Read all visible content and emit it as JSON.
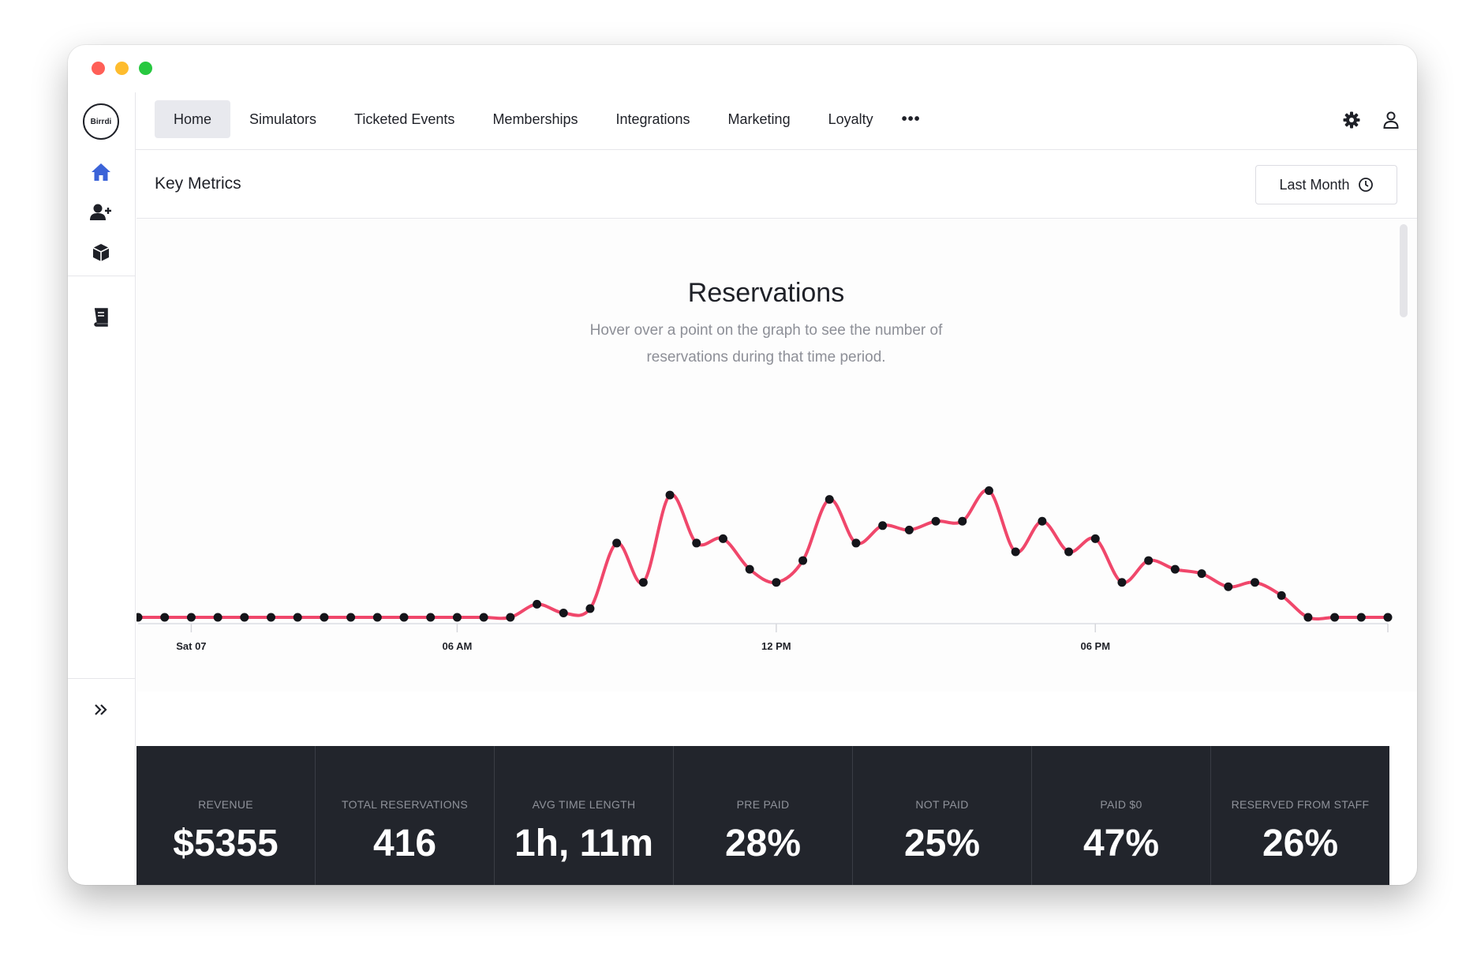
{
  "window": {
    "logo_text": "Birrdi"
  },
  "nav": {
    "items": [
      "Home",
      "Simulators",
      "Ticketed Events",
      "Memberships",
      "Integrations",
      "Marketing",
      "Loyalty"
    ],
    "more": "•••"
  },
  "key_metrics": {
    "title": "Key Metrics",
    "range_label": "Last Month"
  },
  "chart": {
    "title": "Reservations",
    "subtitle_line1": "Hover over a point on the graph to see the number of",
    "subtitle_line2": "reservations during that time period."
  },
  "chart_data": {
    "type": "line",
    "title": "Reservations",
    "xlabel": "",
    "ylabel": "",
    "x_ticks": [
      "Sat 07",
      "06 AM",
      "12 PM",
      "06 PM"
    ],
    "x_tick_hours": [
      1,
      6,
      12,
      18
    ],
    "x_range_hours": [
      0,
      23.5
    ],
    "point_interval_hours": 0.5,
    "values": [
      0,
      0,
      0,
      0,
      0,
      0,
      0,
      0,
      0,
      0,
      0,
      0,
      0,
      0,
      0,
      3,
      1,
      2,
      17,
      8,
      28,
      17,
      18,
      11,
      8,
      13,
      27,
      17,
      21,
      20,
      22,
      22,
      29,
      15,
      22,
      15,
      18,
      8,
      13,
      11,
      10,
      7,
      8,
      5,
      0,
      0,
      0,
      0
    ],
    "ylim": [
      0,
      30
    ],
    "color": "#f0476b",
    "grid": false,
    "legend": "none"
  },
  "stats": [
    {
      "label": "REVENUE",
      "value": "$5355"
    },
    {
      "label": "TOTAL RESERVATIONS",
      "value": "416"
    },
    {
      "label": "AVG TIME LENGTH",
      "value": "1h, 11m"
    },
    {
      "label": "PRE PAID",
      "value": "28%"
    },
    {
      "label": "NOT PAID",
      "value": "25%"
    },
    {
      "label": "PAID $0",
      "value": "47%"
    },
    {
      "label": "RESERVED FROM STAFF",
      "value": "26%"
    }
  ],
  "colors": {
    "accent_home": "#3b63d8",
    "line": "#f0476b",
    "stats_bg": "#22252c"
  },
  "icons": {
    "sidebar": [
      "home-icon",
      "add-user-icon",
      "box-icon",
      "book-icon",
      "expand-icon"
    ],
    "top": [
      "settings-icon",
      "user-icon",
      "clock-icon"
    ]
  }
}
